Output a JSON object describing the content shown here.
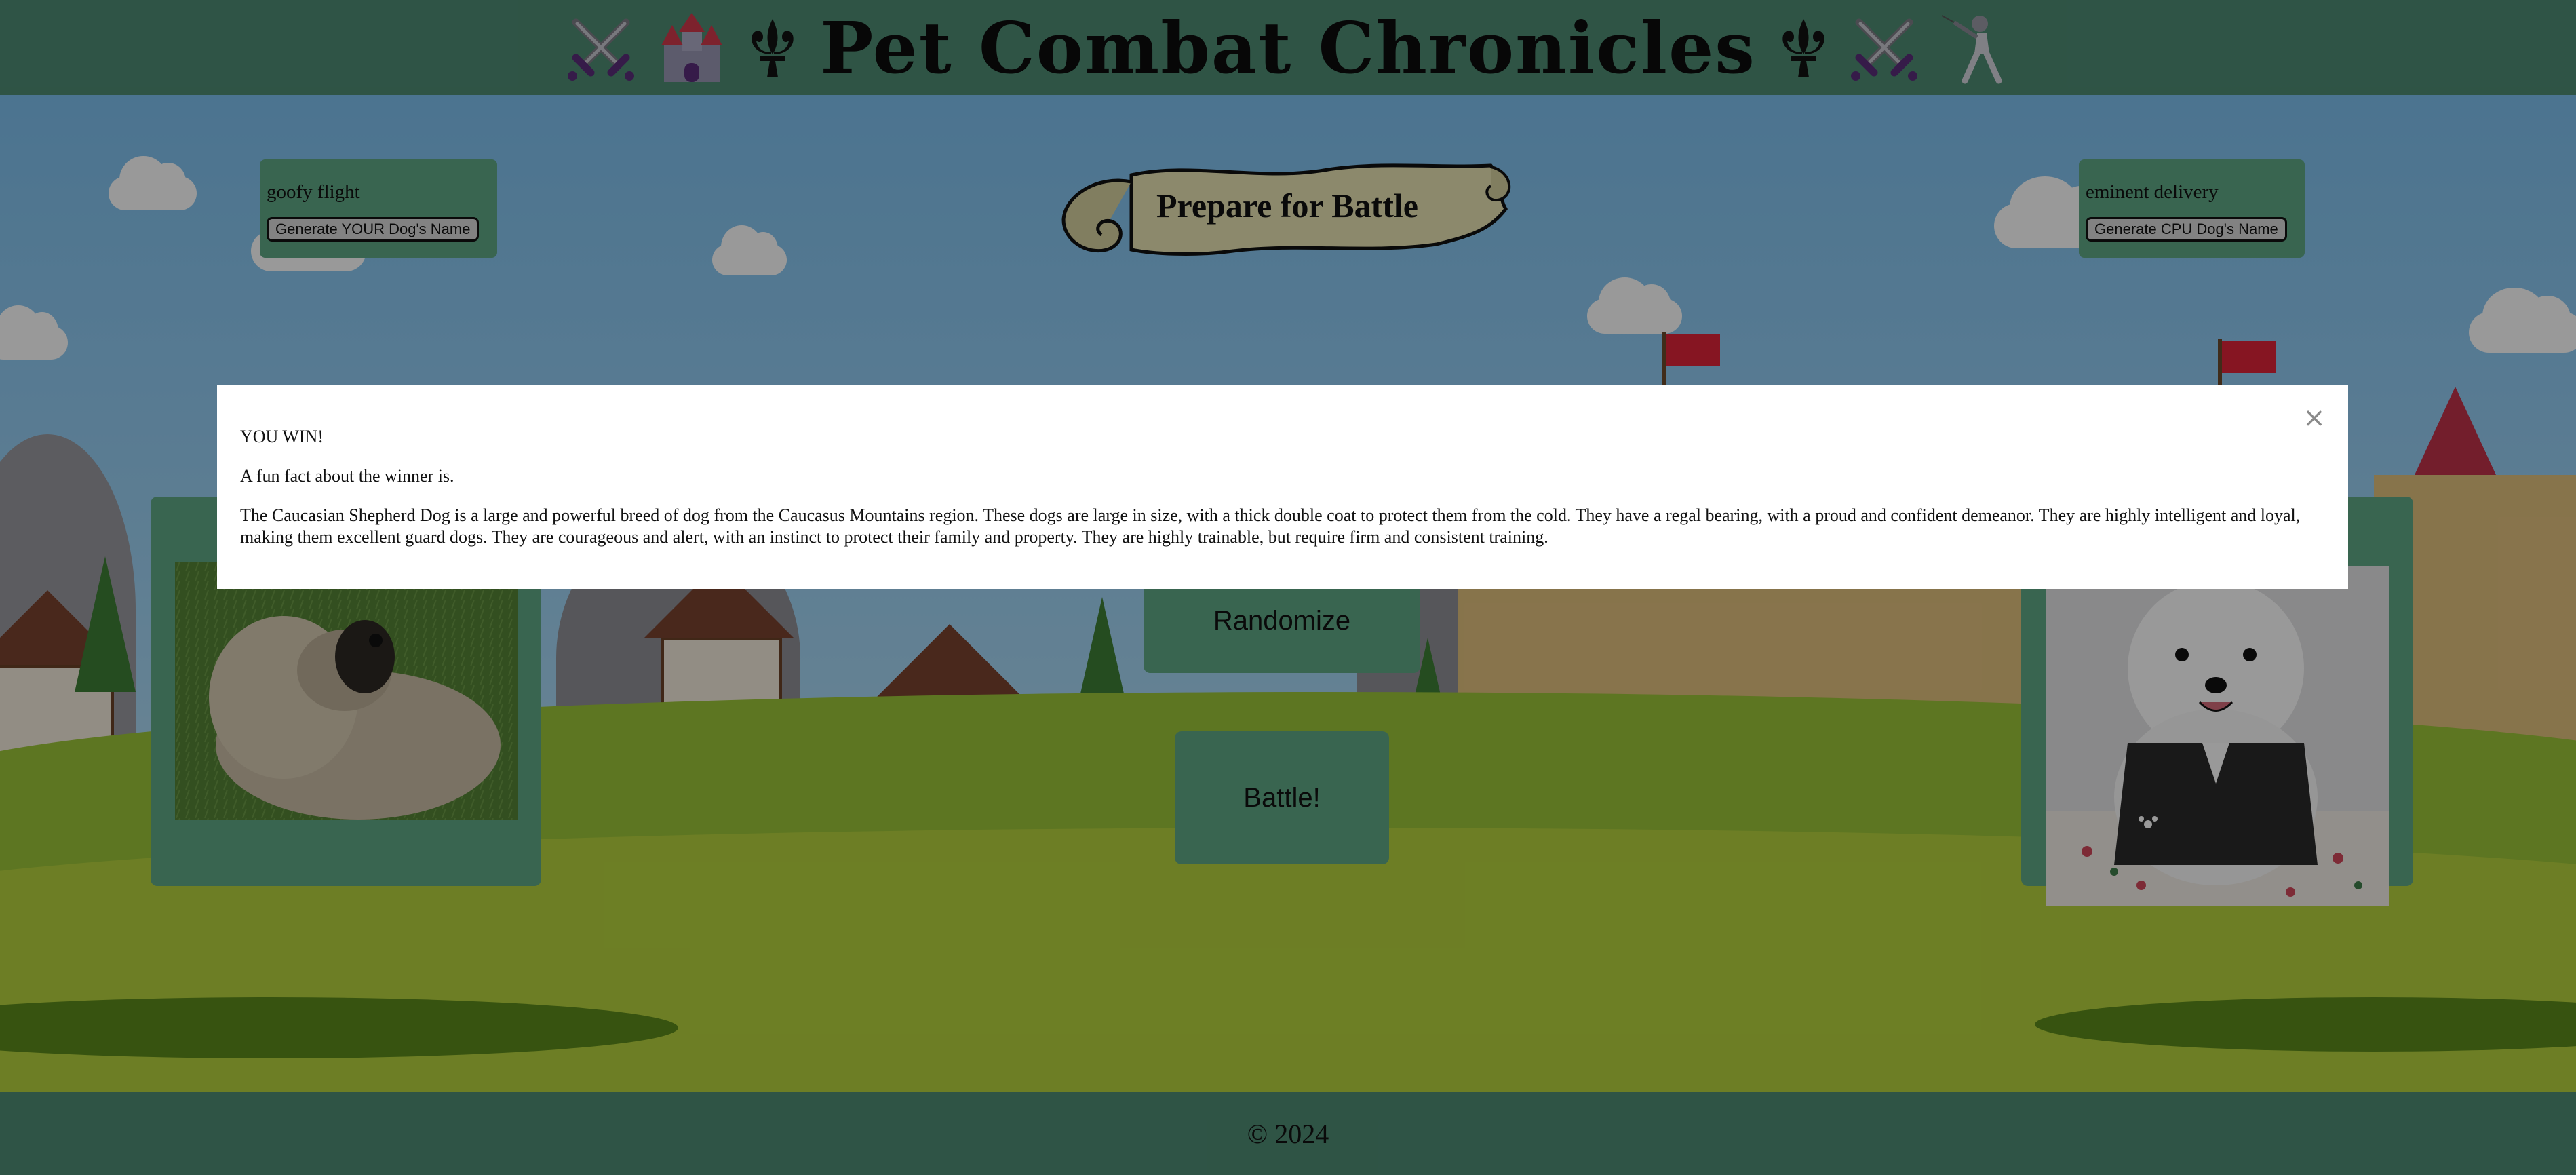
{
  "header": {
    "title": "Pet Combat Chronicles",
    "icons": [
      "crossed-swords-icon",
      "castle-icon",
      "fleur-de-lis-icon",
      "fleur-de-lis-icon",
      "crossed-swords-icon",
      "fencer-icon"
    ]
  },
  "player": {
    "dog_name": "goofy flight",
    "generate_label": "Generate YOUR Dog's Name"
  },
  "cpu": {
    "dog_name": "eminent delivery",
    "generate_label": "Generate CPU Dog's Name"
  },
  "banner": {
    "label": "Prepare for Battle"
  },
  "actions": {
    "randomize_label": "Randomize",
    "battle_label": "Battle!"
  },
  "modal": {
    "result": "YOU WIN!",
    "subtitle": "A fun fact about the winner is.",
    "fact": "The Caucasian Shepherd Dog is a large and powerful breed of dog from the Caucasus Mountains region. These dogs are large in size, with a thick double coat to protect them from the cold. They have a regal bearing, with a proud and confident demeanor. They are highly intelligent and loyal, making them excellent guard dogs. They are courageous and alert, with an instinct to protect their family and property. They are highly trainable, but require firm and consistent training.",
    "close_glyph": "×"
  },
  "footer": {
    "copyright": "© 2024"
  },
  "colors": {
    "header_bg": "#4f8c74",
    "panel_bg": "#5fa886",
    "modal_bg": "#ffffff",
    "overlay": "rgba(0,0,0,0.4)"
  }
}
